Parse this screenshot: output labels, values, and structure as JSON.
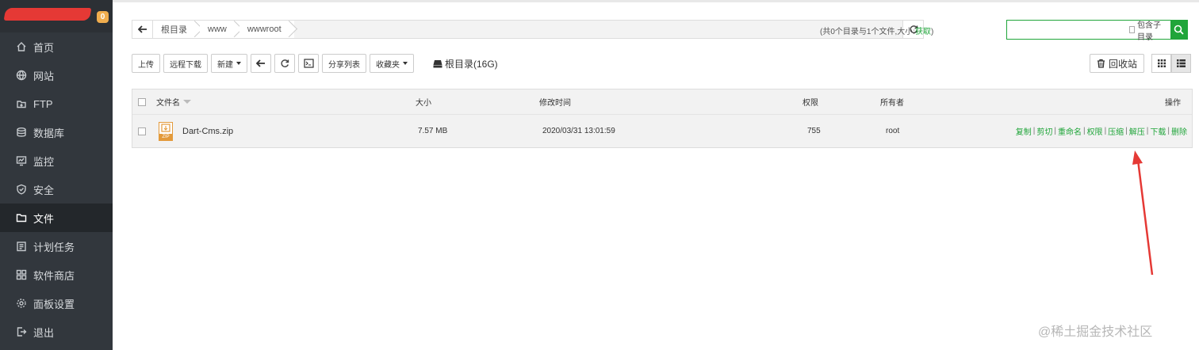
{
  "sidebar": {
    "badge": "0",
    "items": [
      {
        "label": "首页",
        "icon": "home-icon"
      },
      {
        "label": "网站",
        "icon": "globe-icon"
      },
      {
        "label": "FTP",
        "icon": "ftp-icon"
      },
      {
        "label": "数据库",
        "icon": "database-icon"
      },
      {
        "label": "监控",
        "icon": "monitor-icon"
      },
      {
        "label": "安全",
        "icon": "shield-icon"
      },
      {
        "label": "文件",
        "icon": "folder-icon"
      },
      {
        "label": "计划任务",
        "icon": "task-icon"
      },
      {
        "label": "软件商店",
        "icon": "apps-icon"
      },
      {
        "label": "面板设置",
        "icon": "settings-icon"
      },
      {
        "label": "退出",
        "icon": "logout-icon"
      }
    ],
    "active": "文件"
  },
  "path": {
    "crumbs": [
      "根目录",
      "www",
      "wwwroot"
    ]
  },
  "summary": {
    "text": "(共0个目录与1个文件,大小:",
    "link": "获取",
    "close": ")"
  },
  "search": {
    "placeholder": "",
    "include_sub_label": "包含子目录"
  },
  "toolbar": {
    "upload": "上传",
    "remote_download": "远程下载",
    "new": "新建",
    "share_list": "分享列表",
    "favorites": "收藏夹",
    "disk_label": "根目录(16G)",
    "recycle_bin": "回收站"
  },
  "table": {
    "columns": {
      "name": "文件名",
      "size": "大小",
      "mtime": "修改时间",
      "perm": "权限",
      "owner": "所有者",
      "ops": "操作"
    },
    "rows": [
      {
        "name": "Dart-Cms.zip",
        "icon_text": "ZIP",
        "size": "7.57 MB",
        "mtime": "2020/03/31 13:01:59",
        "perm": "755",
        "owner": "root",
        "ops": [
          "复制",
          "剪切",
          "重命名",
          "权限",
          "压缩",
          "解压",
          "下载",
          "删除"
        ]
      }
    ]
  },
  "watermark": "@稀土掘金技术社区",
  "colors": {
    "accent": "#20a53a",
    "sidebar_bg": "#32373d",
    "annotation_arrow": "#e53935",
    "badge": "#f0ad4e"
  }
}
